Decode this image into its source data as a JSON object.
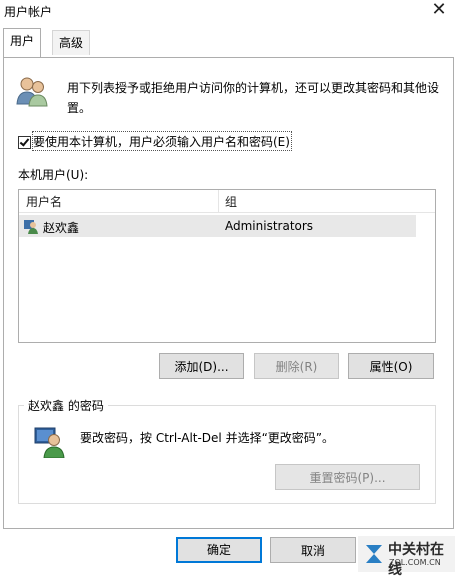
{
  "window": {
    "title": "用户帐户",
    "close_icon": "close-icon"
  },
  "tabs": [
    {
      "label": "用户",
      "active": true
    },
    {
      "label": "高级",
      "active": false
    }
  ],
  "info": {
    "text": "用下列表授予或拒绝用户访问你的计算机，还可以更改其密码和其他设置。",
    "icon": "users-icon"
  },
  "require_login": {
    "label": "要使用本计算机，用户必须输入用户名和密码(E)",
    "checked": true
  },
  "users": {
    "label": "本机用户(U):",
    "columns": [
      "用户名",
      "组"
    ],
    "rows": [
      {
        "name": "赵欢鑫",
        "group": "Administrators",
        "icon": "user-icon"
      }
    ]
  },
  "buttons": {
    "add": "添加(D)...",
    "remove": "删除(R)",
    "properties": "属性(O)"
  },
  "password": {
    "group_label": "赵欢鑫 的密码",
    "text": "要改密码，按 Ctrl-Alt-Del 并选择“更改密码”。",
    "reset_button": "重置密码(P)...",
    "icon": "password-user-icon"
  },
  "dialog": {
    "ok": "确定",
    "cancel": "取消"
  },
  "watermark": {
    "text": "中关村在线",
    "sub": "ZOL.COM.CN"
  }
}
